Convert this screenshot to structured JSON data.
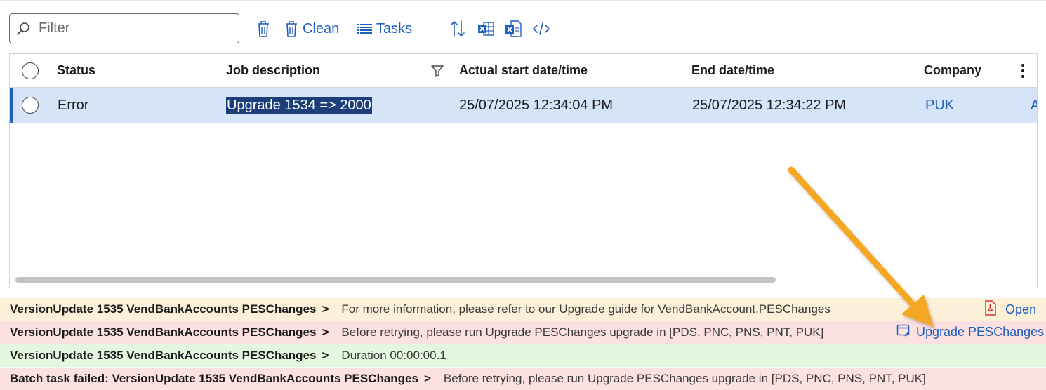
{
  "toolbar": {
    "filter_placeholder": "Filter",
    "delete_icon": "trash-icon",
    "clean_label": "Clean",
    "tasks_label": "Tasks",
    "sort_icon": "sort-icon",
    "excel_icon": "excel-icon",
    "excel_open_icon": "excel-open-icon",
    "code_icon": "code-icon"
  },
  "grid": {
    "columns": {
      "status": "Status",
      "job_description": "Job description",
      "actual_start": "Actual start date/time",
      "end": "End date/time",
      "company": "Company"
    },
    "rows": [
      {
        "status": "Error",
        "job_description": "Upgrade 1534 => 2000",
        "actual_start": "25/07/2025 12:34:04 PM",
        "end": "25/07/2025 12:34:22 PM",
        "company": "PUK",
        "next_column_peek": "A"
      }
    ]
  },
  "messages": [
    {
      "source": "VersionUpdate 1535 VendBankAccounts PESChanges",
      "separator": ">",
      "text": "For more information, please refer to our Upgrade guide for VendBankAccount.PESChanges",
      "action_label": "Open",
      "action_icon": "pdf-icon",
      "severity": "warning"
    },
    {
      "source": "VersionUpdate 1535 VendBankAccounts PESChanges",
      "separator": ">",
      "text": "Before retrying, please run Upgrade PESChanges upgrade in [PDS, PNC, PNS, PNT, PUK]",
      "action_label": "Upgrade PESChanges",
      "action_icon": "open-form-icon",
      "severity": "error"
    },
    {
      "source": "VersionUpdate 1535 VendBankAccounts PESChanges",
      "separator": ">",
      "text": "Duration 00:00:00.1",
      "severity": "success"
    },
    {
      "source": "Batch task failed: VersionUpdate 1535 VendBankAccounts PESChanges",
      "separator": ">",
      "text": "Before retrying, please run Upgrade PESChanges upgrade in [PDS, PNC, PNS, PNT, PUK]",
      "severity": "error"
    }
  ],
  "colors": {
    "accent": "#1f5fbf",
    "selected_row": "#d6e4f7",
    "warning_bg": "#fdf0d8",
    "error_bg": "#fde0e0",
    "success_bg": "#e3f8de",
    "annotation_arrow": "#f5a623"
  }
}
